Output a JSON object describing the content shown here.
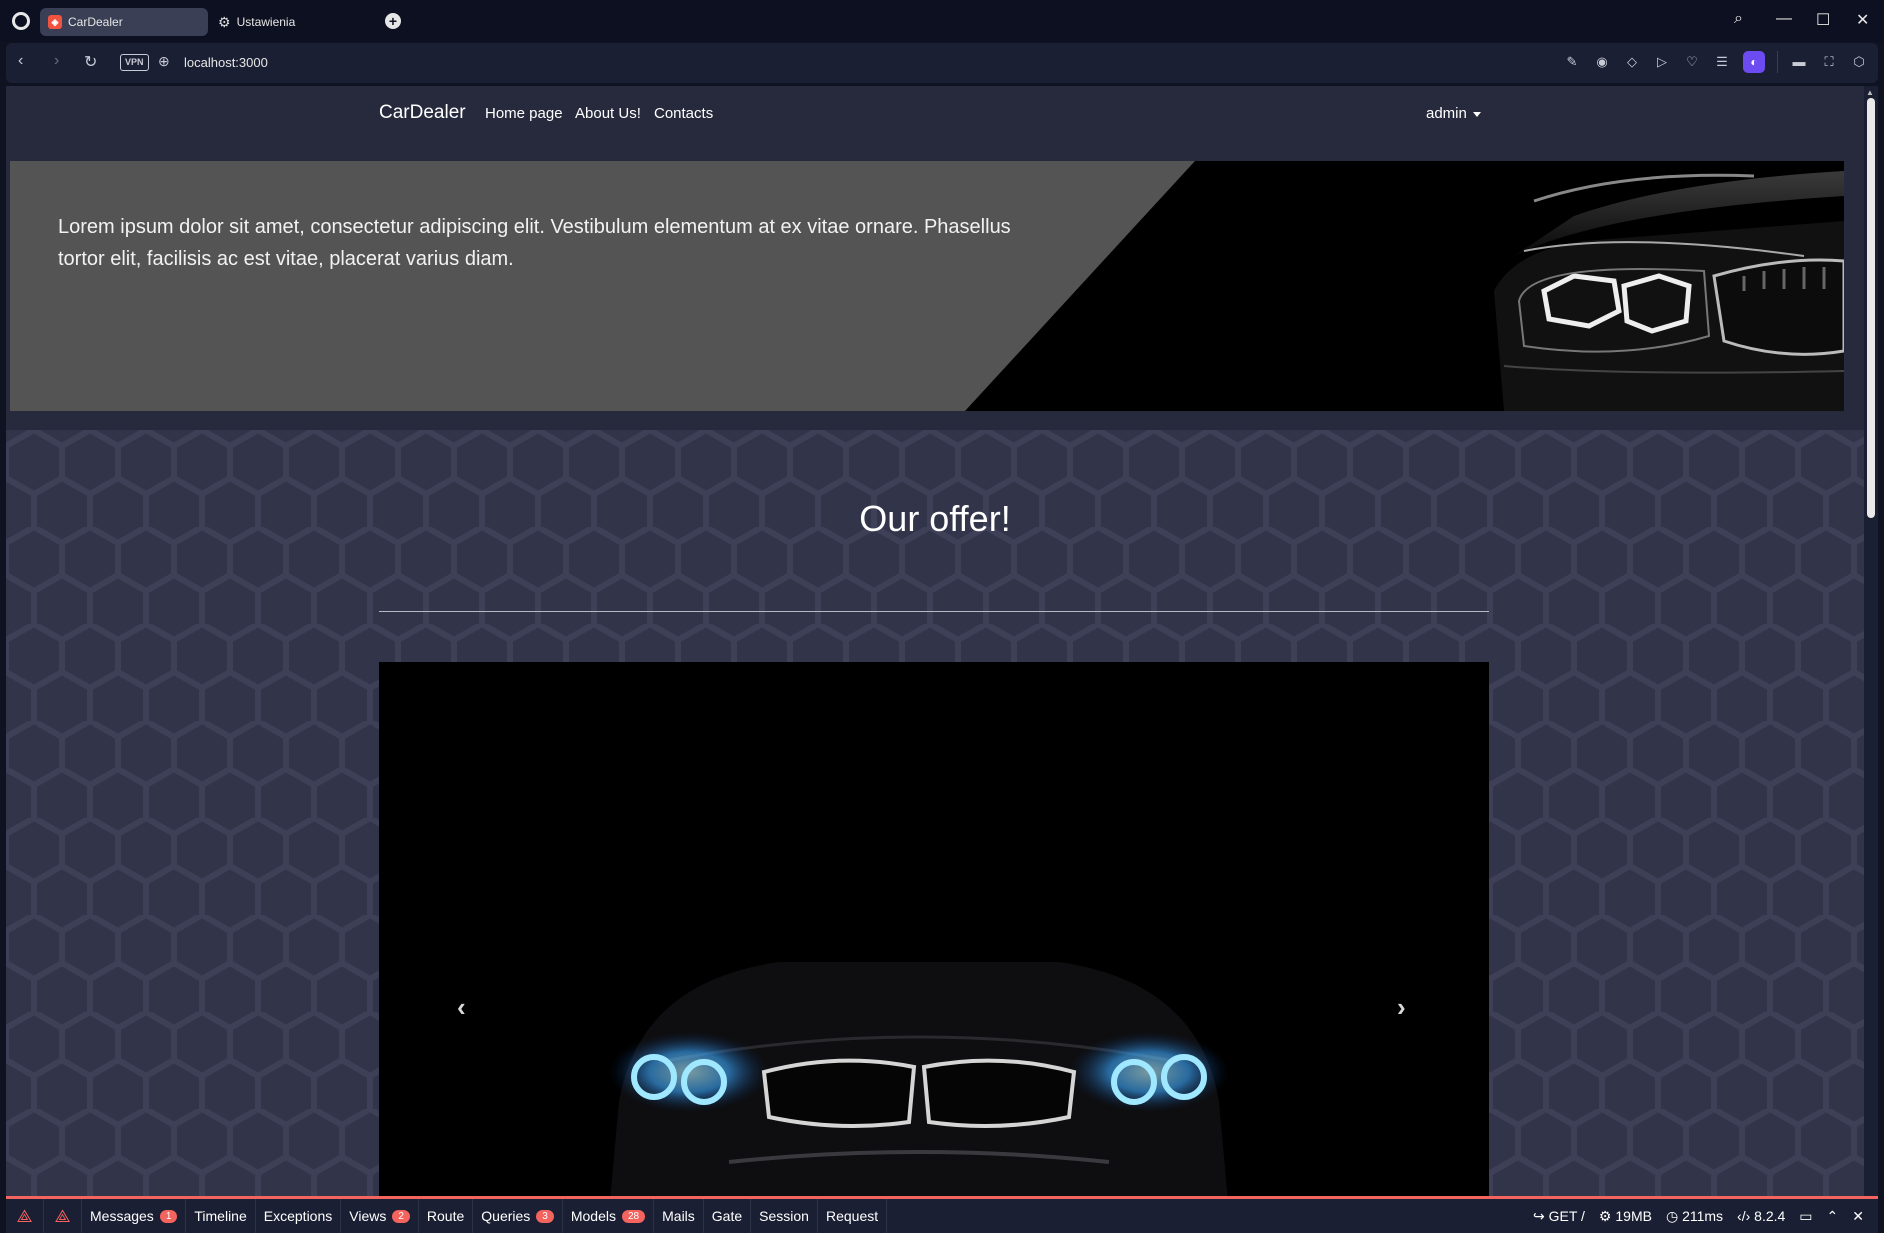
{
  "browser": {
    "tabs": [
      {
        "title": "CarDealer",
        "active": true
      },
      {
        "title": "Ustawienia",
        "active": false
      }
    ],
    "vpn_label": "VPN",
    "url": "localhost:3000"
  },
  "site": {
    "brand": "CarDealer",
    "nav_links": [
      "Home page",
      "About Us!",
      "Contacts"
    ],
    "user_menu": "admin"
  },
  "hero": {
    "text": "Lorem ipsum dolor sit amet, consectetur adipiscing elit. Vestibulum elementum at ex vitae ornare. Phasellus tortor elit, facilisis ac est vitae, placerat varius diam."
  },
  "offer": {
    "title": "Our offer!"
  },
  "debugbar": {
    "items": [
      {
        "label": "Messages",
        "badge": "1"
      },
      {
        "label": "Timeline",
        "badge": ""
      },
      {
        "label": "Exceptions",
        "badge": ""
      },
      {
        "label": "Views",
        "badge": "2"
      },
      {
        "label": "Route",
        "badge": ""
      },
      {
        "label": "Queries",
        "badge": "3"
      },
      {
        "label": "Models",
        "badge": "28"
      },
      {
        "label": "Mails",
        "badge": ""
      },
      {
        "label": "Gate",
        "badge": ""
      },
      {
        "label": "Session",
        "badge": ""
      },
      {
        "label": "Request",
        "badge": ""
      }
    ],
    "method": "GET /",
    "memory": "19MB",
    "time": "211ms",
    "php_version": "8.2.4"
  },
  "colors": {
    "accent": "#f4645f",
    "navbar": "#272a3c",
    "page_bg": "#32344a"
  }
}
